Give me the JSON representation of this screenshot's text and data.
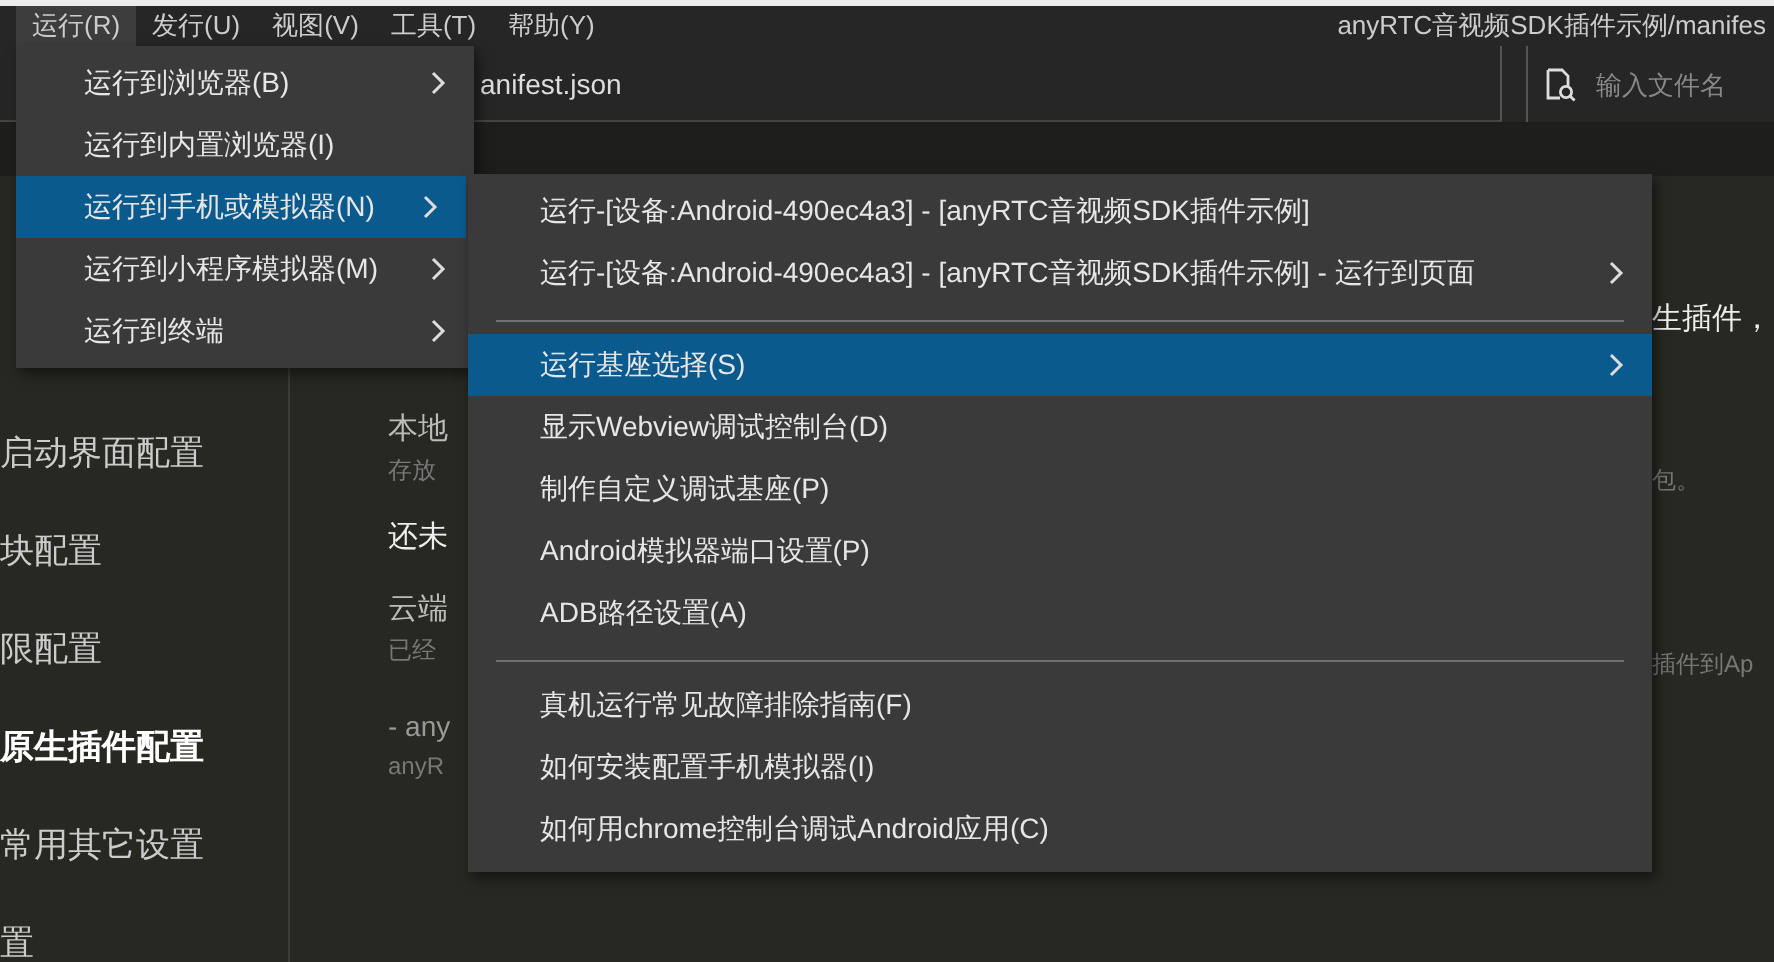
{
  "menubar": {
    "items": [
      {
        "label": "运行(R)",
        "selected": true
      },
      {
        "label": "发行(U)",
        "selected": false
      },
      {
        "label": "视图(V)",
        "selected": false
      },
      {
        "label": "工具(T)",
        "selected": false
      },
      {
        "label": "帮助(Y)",
        "selected": false
      }
    ],
    "title": "anyRTC音视频SDK插件示例/manifes"
  },
  "toolbar": {
    "tab": "anifest.json",
    "search": {
      "placeholder": "输入文件名"
    }
  },
  "sidebar": {
    "items": [
      {
        "label": "启动界面配置",
        "selected": false
      },
      {
        "label": "块配置",
        "selected": false
      },
      {
        "label": "限配置",
        "selected": false
      },
      {
        "label": "原生插件配置",
        "selected": true
      },
      {
        "label": "常用其它设置",
        "selected": false
      },
      {
        "label": "置",
        "selected": false
      }
    ]
  },
  "content": {
    "left": [
      {
        "kind": "heading",
        "text": "本地"
      },
      {
        "kind": "note",
        "text": "存放"
      },
      {
        "kind": "text",
        "text": "还未"
      },
      {
        "kind": "heading",
        "text": "云端"
      },
      {
        "kind": "note",
        "text": "已经"
      },
      {
        "kind": "note",
        "text": "- any"
      },
      {
        "kind": "note",
        "text": "anyR"
      }
    ],
    "right": [
      {
        "kind": "text",
        "text": "生插件，"
      },
      {
        "kind": "note",
        "text": "包。"
      },
      {
        "kind": "note",
        "text": "插件到Ap"
      }
    ]
  },
  "menu": {
    "items": [
      {
        "label": "运行到浏览器(B)",
        "submenu": true,
        "selected": false
      },
      {
        "label": "运行到内置浏览器(I)",
        "submenu": false,
        "selected": false
      },
      {
        "label": "运行到手机或模拟器(N)",
        "submenu": true,
        "selected": true
      },
      {
        "label": "运行到小程序模拟器(M)",
        "submenu": true,
        "selected": false
      },
      {
        "label": "运行到终端",
        "submenu": true,
        "selected": false
      }
    ]
  },
  "submenu": {
    "items": [
      {
        "kind": "item",
        "label": "运行-[设备:Android-490ec4a3] - [anyRTC音视频SDK插件示例]",
        "submenu": false,
        "selected": false
      },
      {
        "kind": "item",
        "label": "运行-[设备:Android-490ec4a3] - [anyRTC音视频SDK插件示例] - 运行到页面",
        "submenu": true,
        "selected": false
      },
      {
        "kind": "separator"
      },
      {
        "kind": "item",
        "label": "运行基座选择(S)",
        "submenu": true,
        "selected": true
      },
      {
        "kind": "item",
        "label": "显示Webview调试控制台(D)",
        "submenu": false,
        "selected": false
      },
      {
        "kind": "item",
        "label": "制作自定义调试基座(P)",
        "submenu": false,
        "selected": false
      },
      {
        "kind": "item",
        "label": "Android模拟器端口设置(P)",
        "submenu": false,
        "selected": false
      },
      {
        "kind": "item",
        "label": "ADB路径设置(A)",
        "submenu": false,
        "selected": false
      },
      {
        "kind": "separator"
      },
      {
        "kind": "item",
        "label": "真机运行常见故障排除指南(F)",
        "submenu": false,
        "selected": false
      },
      {
        "kind": "item",
        "label": "如何安装配置手机模拟器(I)",
        "submenu": false,
        "selected": false
      },
      {
        "kind": "item",
        "label": "如何用chrome控制台调试Android应用(C)",
        "submenu": false,
        "selected": false
      }
    ]
  }
}
